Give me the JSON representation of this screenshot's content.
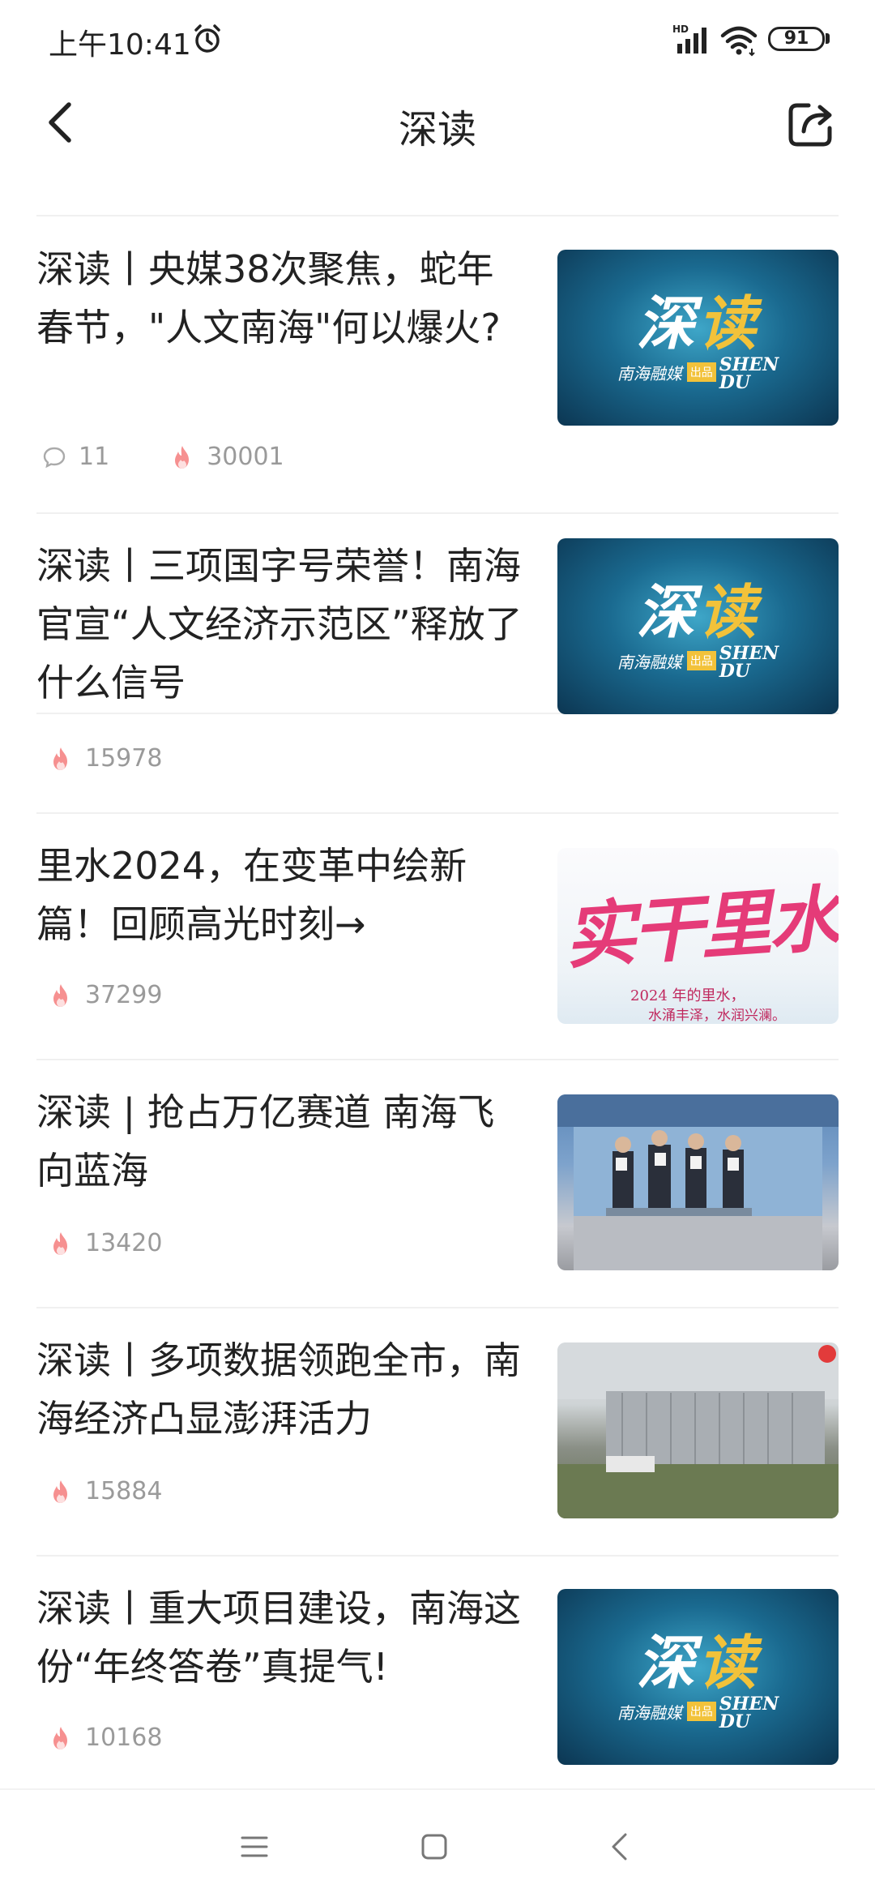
{
  "status_bar": {
    "time": "上午10:41",
    "battery": "91",
    "network": "HD"
  },
  "nav": {
    "title": "深读"
  },
  "articles": [
    {
      "title": "深读丨央媒38次聚焦，蛇年春节，\"人文南海\"何以爆火?",
      "comments": "11",
      "views": "30001",
      "thumb": "shendu"
    },
    {
      "title": "深读丨三项国字号荣誉！南海官宣“人文经济示范区”释放了什么信号",
      "views": "15978",
      "thumb": "shendu"
    },
    {
      "title": "里水2024，在变革中绘新篇！回顾高光时刻→",
      "views": "37299",
      "thumb": "lishui"
    },
    {
      "title": "深读 | 抢占万亿赛道 南海飞向蓝海",
      "views": "13420",
      "thumb": "event"
    },
    {
      "title": "深读丨多项数据领跑全市，南海经济凸显澎湃活力",
      "views": "15884",
      "thumb": "factory"
    },
    {
      "title": "深读丨重大项目建设，南海这份“年终答卷”真提气!",
      "views": "10168",
      "thumb": "shendu"
    }
  ],
  "thumb_text": {
    "shendu_big_1": "深",
    "shendu_big_2": "读",
    "shendu_brand": "南海融媒",
    "shendu_tag": "出品",
    "shendu_en_1": "SHEN",
    "shendu_en_2": "DU",
    "lishui_calli": "实干里水",
    "lishui_cap_1": "2024 年的里水，",
    "lishui_cap_2": "水涌丰泽，水润兴澜。"
  },
  "colors": {
    "accent_flame": "#f47c7c",
    "meta_gray": "#9a9a9a",
    "divider": "#f0f0f0"
  },
  "icons": {
    "back": "chevron-left-icon",
    "share": "share-icon",
    "comment": "comment-icon",
    "views": "flame-icon",
    "menu": "menu-icon",
    "home": "home-icon",
    "nav_back": "back-icon"
  }
}
